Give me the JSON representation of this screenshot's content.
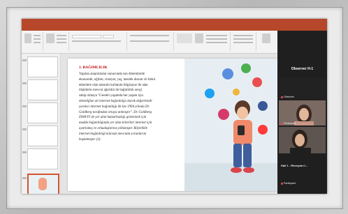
{
  "video_panel": {
    "host_title": "Observer H-1",
    "participants": [
      {
        "label": "Observer"
      },
      {
        "label": "Participant"
      },
      {
        "label": ""
      },
      {
        "label": "Hall 1 - Rüveyda C..."
      },
      {
        "label": "Participant"
      }
    ]
  },
  "slide": {
    "title": "1. BAĞIMLILIK",
    "body_lines": [
      "Yapılan araştırmalar sonucunda son dönemlerde",
      "ekonomik, eğitim, cinsiyet, yaş, meslek durum vb farklı",
      "etkenlere olan takıntılı kullanım bilgisayar ile alan",
      "ilişkilerin mevcut ağırlıklı ile bağımlılık sevgi",
      "sahip olmaya \"Gerekli yaşamda her yaşam için",
      "etkenliğine ait internet bağımlılığı olarak değerlendir",
      "yaratıcı internet bağımlılığı ilk kez 1994 yılında Dr.",
      "Goldberg tarafından ortaya atılmıştır\". Dr. Goldberg",
      "DSM-IV de yer alan kumarbazlığı göstermek için",
      "madde bağımlılığında yer alan kriterleri internet için",
      "uyarlamış ve arkadaşlarına yollamıştır. Böylelikle",
      "internet bağımlılığı kılavuzi mevcutlu sorunlarını",
      "başlatmıştır (2)."
    ]
  },
  "colors": {
    "accent": "#b7472a",
    "title_red": "#c00000"
  }
}
